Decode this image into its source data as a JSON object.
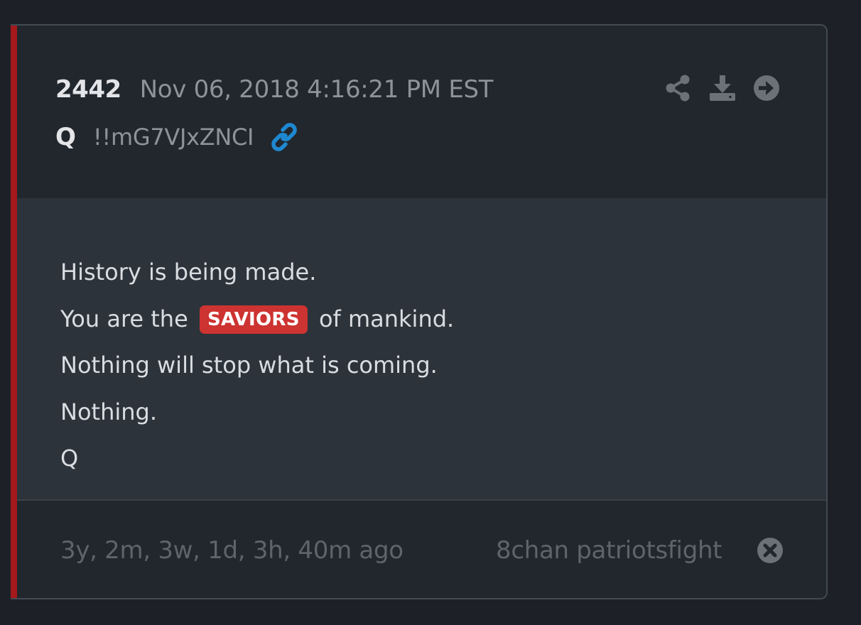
{
  "post": {
    "number": "2442",
    "date": "Nov 06, 2018 4:16:21 PM EST",
    "author": "Q",
    "tripcode": "!!mG7VJxZNCI"
  },
  "icons": {
    "link": "link-icon",
    "share": "share-icon",
    "download": "download-icon",
    "next": "arrow-right-circle-icon",
    "close": "close-circle-icon"
  },
  "body": {
    "line1": "History is being made.",
    "line2_before": "You are the",
    "line2_highlight": "SAVIORS",
    "line2_after": "of mankind.",
    "line3": "Nothing will stop what is coming.",
    "line4": "Nothing.",
    "line5": "Q"
  },
  "footer": {
    "ago": "3y, 2m, 3w, 1d, 3h, 40m ago",
    "source": "8chan patriotsfight"
  },
  "colors": {
    "accent": "#a4191c",
    "highlight": "#cd3331",
    "link": "#1e88d0"
  }
}
